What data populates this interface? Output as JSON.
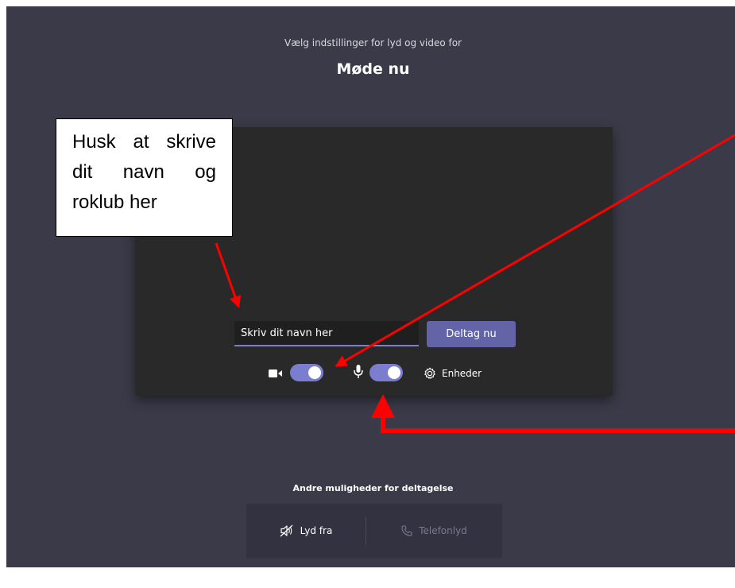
{
  "header": {
    "subtitle": "Vælg indstillinger for lyd og video for",
    "meeting_title": "Møde nu"
  },
  "prejoin": {
    "name_input": {
      "value": "Skriv dit navn her",
      "placeholder": "Skriv dit navn her"
    },
    "join_button": "Deltag nu",
    "camera_enabled": true,
    "mic_enabled": true,
    "devices_label": "Enheder"
  },
  "other_options": {
    "title": "Andre muligheder for deltagelse",
    "audio_off": "Lyd fra",
    "phone_audio": "Telefonlyd"
  },
  "annotation": {
    "callout_text": "Husk at skrive dit navn og roklub her",
    "arrow_color": "#ff0000"
  },
  "colors": {
    "background": "#3b3a48",
    "preview": "#292929",
    "accent": "#6264a7",
    "toggle": "#7b7dcf"
  }
}
